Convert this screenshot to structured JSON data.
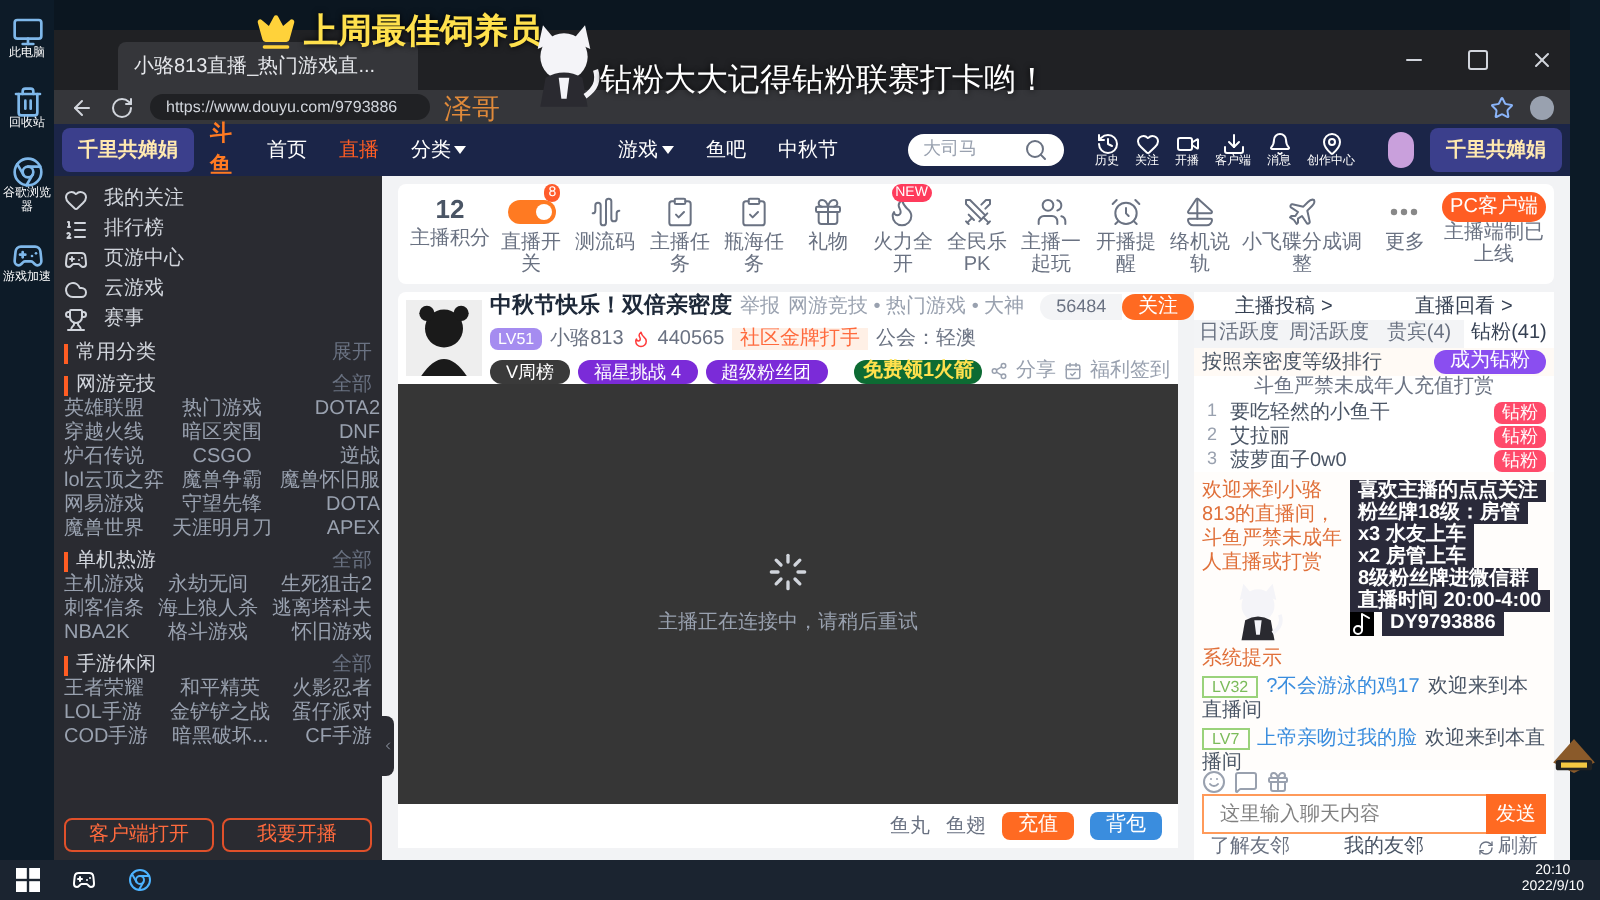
{
  "desktop_icons": [
    {
      "label": "此电脑"
    },
    {
      "label": "回收站"
    },
    {
      "label": "谷歌浏览器"
    },
    {
      "label": "游戏加速"
    }
  ],
  "overlay": {
    "banner": "上周最佳饲养员",
    "name": "泽哥",
    "message": "钻粉大大记得钻粉联赛打卡哟！",
    "info_lines": [
      "喜欢主播的点点关注",
      "粉丝牌18级：房管",
      "x3 水友上车",
      "x2 房管上车",
      "8级粉丝牌进微信群",
      "直播时间 20:00-4:00"
    ],
    "account": "DY9793886"
  },
  "browser": {
    "tab_title": "小骆813直播_热门游戏直...",
    "url": "https://www.douyu.com/9793886"
  },
  "nav": {
    "banners": [
      "千里共婵娟",
      "千里共婵娟"
    ],
    "logo": "斗鱼",
    "items": [
      {
        "label": "首页",
        "selected": false,
        "dropdown": false
      },
      {
        "label": "直播",
        "selected": true,
        "dropdown": false
      },
      {
        "label": "分类",
        "selected": false,
        "dropdown": true
      },
      {
        "label": "游戏",
        "selected": false,
        "dropdown": true
      },
      {
        "label": "鱼吧",
        "selected": false,
        "dropdown": false
      },
      {
        "label": "中秋节",
        "selected": false,
        "dropdown": false
      }
    ],
    "search_placeholder": "大司马",
    "icons": [
      {
        "label": "历史"
      },
      {
        "label": "关注"
      },
      {
        "label": "开播"
      },
      {
        "label": "客户端"
      },
      {
        "label": "消息"
      },
      {
        "label": "创作中心"
      }
    ]
  },
  "sidebar": {
    "top_items": [
      {
        "label": "我的关注"
      },
      {
        "label": "排行榜"
      },
      {
        "label": "页游中心"
      },
      {
        "label": "云游戏"
      },
      {
        "label": "赛事"
      }
    ],
    "sections": [
      {
        "title": "常用分类",
        "more": "展开"
      },
      {
        "title": "网游竞技",
        "more": "全部",
        "items": [
          "英雄联盟",
          "热门游戏",
          "DOTA2",
          "穿越火线",
          "暗区突围",
          "DNF",
          "炉石传说",
          "CSGO",
          "逆战",
          "lol云顶之弈",
          "魔兽争霸",
          "魔兽怀旧服",
          "网易游戏",
          "守望先锋",
          "DOTA",
          "魔兽世界",
          "天涯明月刀",
          "APEX"
        ]
      },
      {
        "title": "单机热游",
        "more": "全部",
        "items": [
          "主机游戏",
          "永劫无间",
          "生死狙击2",
          "刺客信条",
          "海上狼人杀",
          "逃离塔科夫",
          "NBA2K",
          "格斗游戏",
          "怀旧游戏"
        ]
      },
      {
        "title": "手游休闲",
        "more": "全部",
        "items": [
          "王者荣耀",
          "和平精英",
          "火影忍者",
          "LOL手游",
          "金铲铲之战",
          "蛋仔派对",
          "COD手游",
          "暗黑破坏...",
          "CF手游"
        ]
      }
    ],
    "buttons": [
      "客户端打开",
      "我要开播"
    ]
  },
  "toolbar": {
    "score": "12",
    "score_label": "主播积分",
    "tools": [
      {
        "label": "直播开关",
        "kind": "toggle",
        "on": true,
        "badge": "8"
      },
      {
        "label": "测流码",
        "kind": "icon"
      },
      {
        "label": "主播任务",
        "kind": "icon"
      },
      {
        "label": "瓶海任务",
        "kind": "icon"
      },
      {
        "label": "礼物",
        "kind": "icon"
      },
      {
        "label": "火力全开",
        "kind": "icon",
        "badge": "NEW"
      },
      {
        "label": "全民乐PK",
        "kind": "icon"
      },
      {
        "label": "主播一起玩",
        "kind": "icon"
      },
      {
        "label": "开播提醒",
        "kind": "icon"
      },
      {
        "label": "络机说轨",
        "kind": "icon"
      },
      {
        "label": "小飞碟分成调整",
        "kind": "icon"
      },
      {
        "label": "更多",
        "kind": "icon"
      }
    ],
    "pc_button": "PC客户端",
    "pc_note": "主播端制已上线"
  },
  "streamer": {
    "title": "中秋节快乐！双倍亲密度",
    "report": "举报",
    "category": "网游竞技 • 热门游戏 • 大神",
    "level": "LV51",
    "name": "小骆813",
    "heat": "440565",
    "tag": "社区金牌打手",
    "guild": "公会：轻澳",
    "badges": [
      "V周榜",
      "福星挑战 4",
      "超级粉丝团"
    ],
    "followers": "56484",
    "follow": "关注",
    "rocket": "免费领1火箭",
    "share": "分享",
    "signin": "福利签到"
  },
  "video": {
    "status": "主播正在连接中，请稍后重试"
  },
  "player_bar": {
    "items": [
      "鱼丸",
      "鱼翅"
    ],
    "recharge": "充值",
    "bag": "背包"
  },
  "right": {
    "links": [
      "主播投稿 >",
      "直播回看 >"
    ],
    "tabs": [
      {
        "label": "日活跃度",
        "selected": false
      },
      {
        "label": "周活跃度",
        "selected": false
      },
      {
        "label": "贵宾(4)",
        "selected": false
      },
      {
        "label": "钻粉(41)",
        "selected": true
      }
    ],
    "rank_title": "按照亲密度等级排行",
    "rank_button": "成为钻粉",
    "notice": "斗鱼严禁未成年人充值打赏",
    "ranks": [
      {
        "no": "1",
        "name": "要吃轻然的小鱼干",
        "badge": "钻粉"
      },
      {
        "no": "2",
        "name": "艾拉丽",
        "badge": "钻粉"
      },
      {
        "no": "3",
        "name": "菠萝面子0w0",
        "badge": "钻粉"
      }
    ],
    "welcome": "欢迎来到小骆813的直播间，斗鱼严禁未成年人直播或打赏",
    "system": "系统提示",
    "chats": [
      {
        "level": "LV32",
        "user": "?不会游泳的鸡17",
        "text": "欢迎来到本直播间"
      },
      {
        "level": "LV7",
        "user": "上帝亲吻过我的脸",
        "text": "欢迎来到本直播间"
      }
    ],
    "input_placeholder": "这里输入聊天内容",
    "send": "发送",
    "friends_help": "了解友邻",
    "friends": "我的友邻",
    "refresh": "刷新"
  },
  "taskbar": {
    "time": "20:10",
    "date": "2022/9/10"
  }
}
